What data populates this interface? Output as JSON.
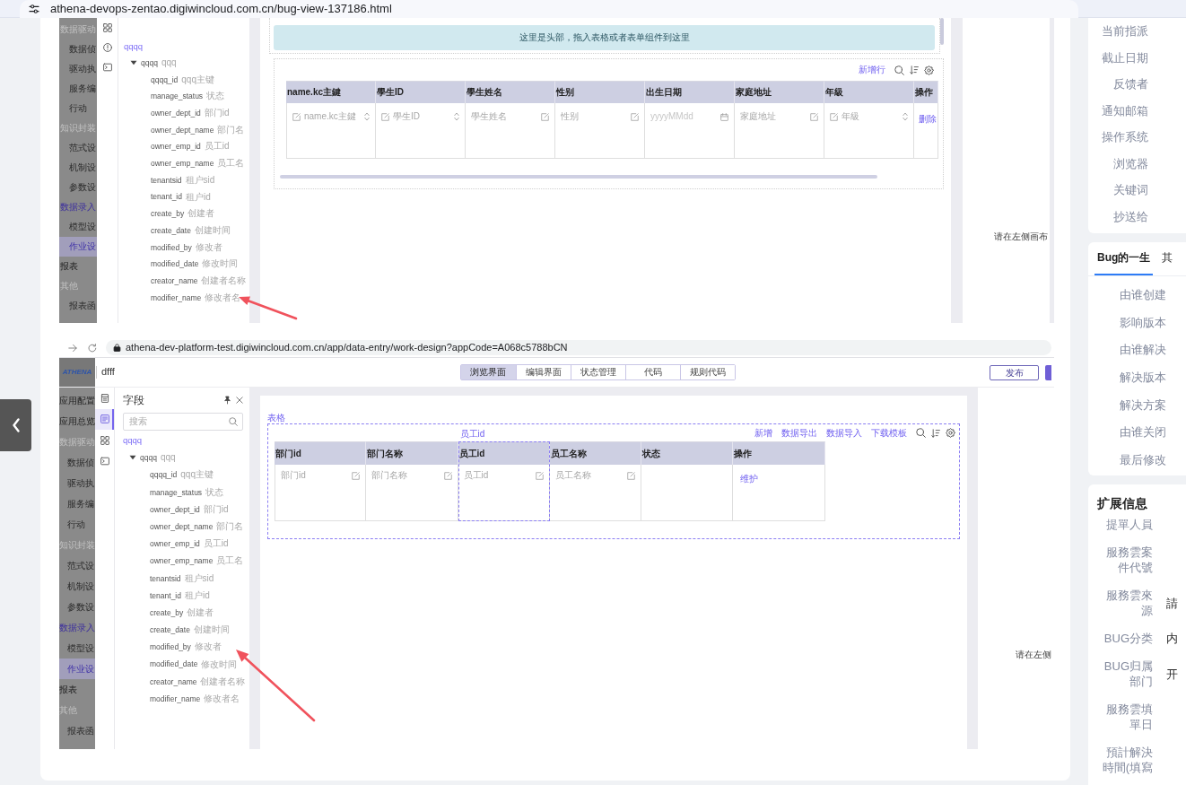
{
  "address_bar": {
    "url": "athena-devops-zentao.digiwincloud.com.cn/bug-view-137186.html"
  },
  "screenshots": [
    {
      "nav": [
        {
          "label": "数据驱动",
          "selected": false,
          "children": [
            {
              "label": "数据侦",
              "selected": false
            },
            {
              "label": "驱动执",
              "selected": false
            },
            {
              "label": "服务编",
              "selected": false
            },
            {
              "label": "行动",
              "selected": false
            }
          ]
        },
        {
          "label": "知识封装",
          "selected": false,
          "children": [
            {
              "label": "范式设",
              "selected": false
            },
            {
              "label": "机制设",
              "selected": false
            },
            {
              "label": "参数设",
              "selected": false
            }
          ]
        },
        {
          "label": "数据录入",
          "selected": true,
          "children": [
            {
              "label": "模型设",
              "selected": false
            },
            {
              "label": "作业设",
              "selected": true
            }
          ]
        },
        {
          "label": "报表",
          "selected": false
        },
        {
          "label": "其他",
          "selected": false,
          "children": [
            {
              "label": "报表函",
              "selected": false
            }
          ]
        }
      ],
      "rail": [
        {
          "kind": "grid",
          "selected": false
        },
        {
          "kind": "info",
          "selected": false
        },
        {
          "kind": "console",
          "selected": false
        }
      ],
      "field_panel": {
        "tree": [
          {
            "name": "qqqq",
            "children": [
              {
                "name": "qqqq",
                "label": "qqq",
                "expanded": true,
                "children": [
                  {
                    "name": "qqqq_id",
                    "label": "qqq主键"
                  },
                  {
                    "name": "manage_status",
                    "label": "状态"
                  },
                  {
                    "name": "owner_dept_id",
                    "label": "部门id"
                  },
                  {
                    "name": "owner_dept_name",
                    "label": "部门名"
                  },
                  {
                    "name": "owner_emp_id",
                    "label": "员工id"
                  },
                  {
                    "name": "owner_emp_name",
                    "label": "员工名"
                  },
                  {
                    "name": "tenantsid",
                    "label": "租户sid"
                  },
                  {
                    "name": "tenant_id",
                    "label": "租户id"
                  },
                  {
                    "name": "create_by",
                    "label": "创建者"
                  },
                  {
                    "name": "create_date",
                    "label": "创建时间"
                  },
                  {
                    "name": "modified_by",
                    "label": "修改者"
                  },
                  {
                    "name": "modified_date",
                    "label": "修改时间"
                  },
                  {
                    "name": "creator_name",
                    "label": "创建者名称"
                  },
                  {
                    "name": "modifier_name",
                    "label": "修改者名"
                  }
                ]
              }
            ]
          }
        ]
      },
      "canvas": {
        "banner": "这里是头部，拖入表格或者表单组件到这里",
        "table": {
          "toolbar": [
            "新增行"
          ],
          "columns": [
            {
              "header": "name.kc主鍵",
              "selected": false,
              "cell": {
                "kind": "number",
                "placeholder": "name.kc主鍵"
              }
            },
            {
              "header": "學生ID",
              "selected": false,
              "cell": {
                "kind": "number",
                "placeholder": "學生ID"
              }
            },
            {
              "header": "學生姓名",
              "selected": false,
              "cell": {
                "kind": "text",
                "placeholder": "學生姓名"
              }
            },
            {
              "header": "性别",
              "selected": false,
              "cell": {
                "kind": "text",
                "placeholder": "性别"
              }
            },
            {
              "header": "出生日期",
              "selected": false,
              "cell": {
                "kind": "date",
                "placeholder": "yyyyMMdd"
              }
            },
            {
              "header": "家庭地址",
              "selected": false,
              "cell": {
                "kind": "text",
                "placeholder": "家庭地址"
              }
            },
            {
              "header": "年級",
              "selected": false,
              "cell": {
                "kind": "number",
                "placeholder": "年級"
              }
            },
            {
              "header": "操作",
              "selected": false,
              "cell": {
                "kind": "action",
                "text": "删除"
              }
            }
          ]
        }
      },
      "hint": "请在左侧画布"
    },
    {
      "browser_bar": {
        "url": "athena-dev-platform-test.digiwincloud.com.cn/app/data-entry/work-design?appCode=A068c5788bCN"
      },
      "header": {
        "logo": "ATHENA",
        "app_name": "dfff",
        "view_tabs": [
          {
            "label": "浏览界面",
            "selected": true
          },
          {
            "label": "编辑界面",
            "selected": false
          },
          {
            "label": "状态管理",
            "selected": false
          },
          {
            "label": "代码",
            "selected": false
          },
          {
            "label": "规则代码",
            "selected": false
          }
        ],
        "publish_button": "发布"
      },
      "nav": [
        {
          "label": "应用配置",
          "selected": false
        },
        {
          "label": "应用总览",
          "selected": false
        },
        {
          "label": "数据驱动",
          "selected": false,
          "children": [
            {
              "label": "数据侦",
              "selected": false
            },
            {
              "label": "驱动执",
              "selected": false
            },
            {
              "label": "服务编",
              "selected": false
            },
            {
              "label": "行动",
              "selected": false
            }
          ]
        },
        {
          "label": "知识封装",
          "selected": false,
          "children": [
            {
              "label": "范式设",
              "selected": false
            },
            {
              "label": "机制设",
              "selected": false
            },
            {
              "label": "参数设",
              "selected": false
            }
          ]
        },
        {
          "label": "数据录入",
          "selected": true,
          "children": [
            {
              "label": "模型设",
              "selected": false
            },
            {
              "label": "作业设",
              "selected": true
            }
          ]
        },
        {
          "label": "报表",
          "selected": false
        },
        {
          "label": "其他",
          "selected": false,
          "children": [
            {
              "label": "报表函",
              "selected": false
            }
          ]
        }
      ],
      "rail": [
        {
          "kind": "page",
          "selected": false
        },
        {
          "kind": "form",
          "selected": true
        },
        {
          "kind": "grid",
          "selected": false
        },
        {
          "kind": "console",
          "selected": false
        }
      ],
      "field_panel": {
        "title": "字段",
        "search_placeholder": "搜索",
        "tree": [
          {
            "name": "qqqq",
            "children": [
              {
                "name": "qqqq",
                "label": "qqq",
                "expanded": true,
                "children": [
                  {
                    "name": "qqqq_id",
                    "label": "qqq主键"
                  },
                  {
                    "name": "manage_status",
                    "label": "状态"
                  },
                  {
                    "name": "owner_dept_id",
                    "label": "部门id"
                  },
                  {
                    "name": "owner_dept_name",
                    "label": "部门名"
                  },
                  {
                    "name": "owner_emp_id",
                    "label": "员工id"
                  },
                  {
                    "name": "owner_emp_name",
                    "label": "员工名"
                  },
                  {
                    "name": "tenantsid",
                    "label": "租户sid"
                  },
                  {
                    "name": "tenant_id",
                    "label": "租户id"
                  },
                  {
                    "name": "create_by",
                    "label": "创建者"
                  },
                  {
                    "name": "create_date",
                    "label": "创建时间"
                  },
                  {
                    "name": "modified_by",
                    "label": "修改者"
                  },
                  {
                    "name": "modified_date",
                    "label": "修改时间"
                  },
                  {
                    "name": "creator_name",
                    "label": "创建者名称"
                  },
                  {
                    "name": "modifier_name",
                    "label": "修改者名"
                  }
                ]
              }
            ]
          }
        ]
      },
      "canvas": {
        "table_label": "表格",
        "table": {
          "toolbar": [
            "新增",
            "数据导出",
            "数据导入",
            "下载模板"
          ],
          "columns": [
            {
              "header": "部门id",
              "selected": false,
              "cell": {
                "kind": "text",
                "placeholder": "部门id"
              }
            },
            {
              "header": "部门名称",
              "selected": false,
              "cell": {
                "kind": "text",
                "placeholder": "部门名称"
              }
            },
            {
              "header": "员工id",
              "selected": true,
              "tag": "员工id",
              "cell": {
                "kind": "text",
                "placeholder": "员工id"
              }
            },
            {
              "header": "员工名称",
              "selected": false,
              "cell": {
                "kind": "text",
                "placeholder": "员工名称"
              }
            },
            {
              "header": "状态",
              "selected": false,
              "cell": {
                "kind": "empty"
              }
            },
            {
              "header": "操作",
              "selected": false,
              "cell": {
                "kind": "action",
                "text": "维护"
              }
            }
          ]
        }
      },
      "hint": "请在左侧"
    }
  ],
  "bug_fields": [
    {
      "label": "当前指派"
    },
    {
      "label": "截止日期"
    },
    {
      "label": "反馈者"
    },
    {
      "label": "通知邮箱"
    },
    {
      "label": "操作系统"
    },
    {
      "label": "浏览器"
    },
    {
      "label": "关键词"
    },
    {
      "label": "抄送给"
    }
  ],
  "life": {
    "tabs": [
      {
        "label": "Bug的一生",
        "selected": true
      },
      {
        "label": "其",
        "selected": false
      }
    ],
    "rows": [
      {
        "label": "由谁创建"
      },
      {
        "label": "影响版本"
      },
      {
        "label": "由谁解决"
      },
      {
        "label": "解决版本"
      },
      {
        "label": "解决方案"
      },
      {
        "label": "由谁关闭"
      },
      {
        "label": "最后修改"
      }
    ]
  },
  "extra": {
    "title": "扩展信息",
    "rows": [
      {
        "label": "提單人員"
      },
      {
        "label": "服務雲案件代號"
      },
      {
        "label": "服務雲來源",
        "value": "請"
      },
      {
        "label": "BUG分类",
        "value": "内"
      },
      {
        "label": "BUG归属部门",
        "value": "开"
      },
      {
        "label": "服務雲填單日"
      },
      {
        "label": "預計解決時間(填寫"
      }
    ]
  }
}
